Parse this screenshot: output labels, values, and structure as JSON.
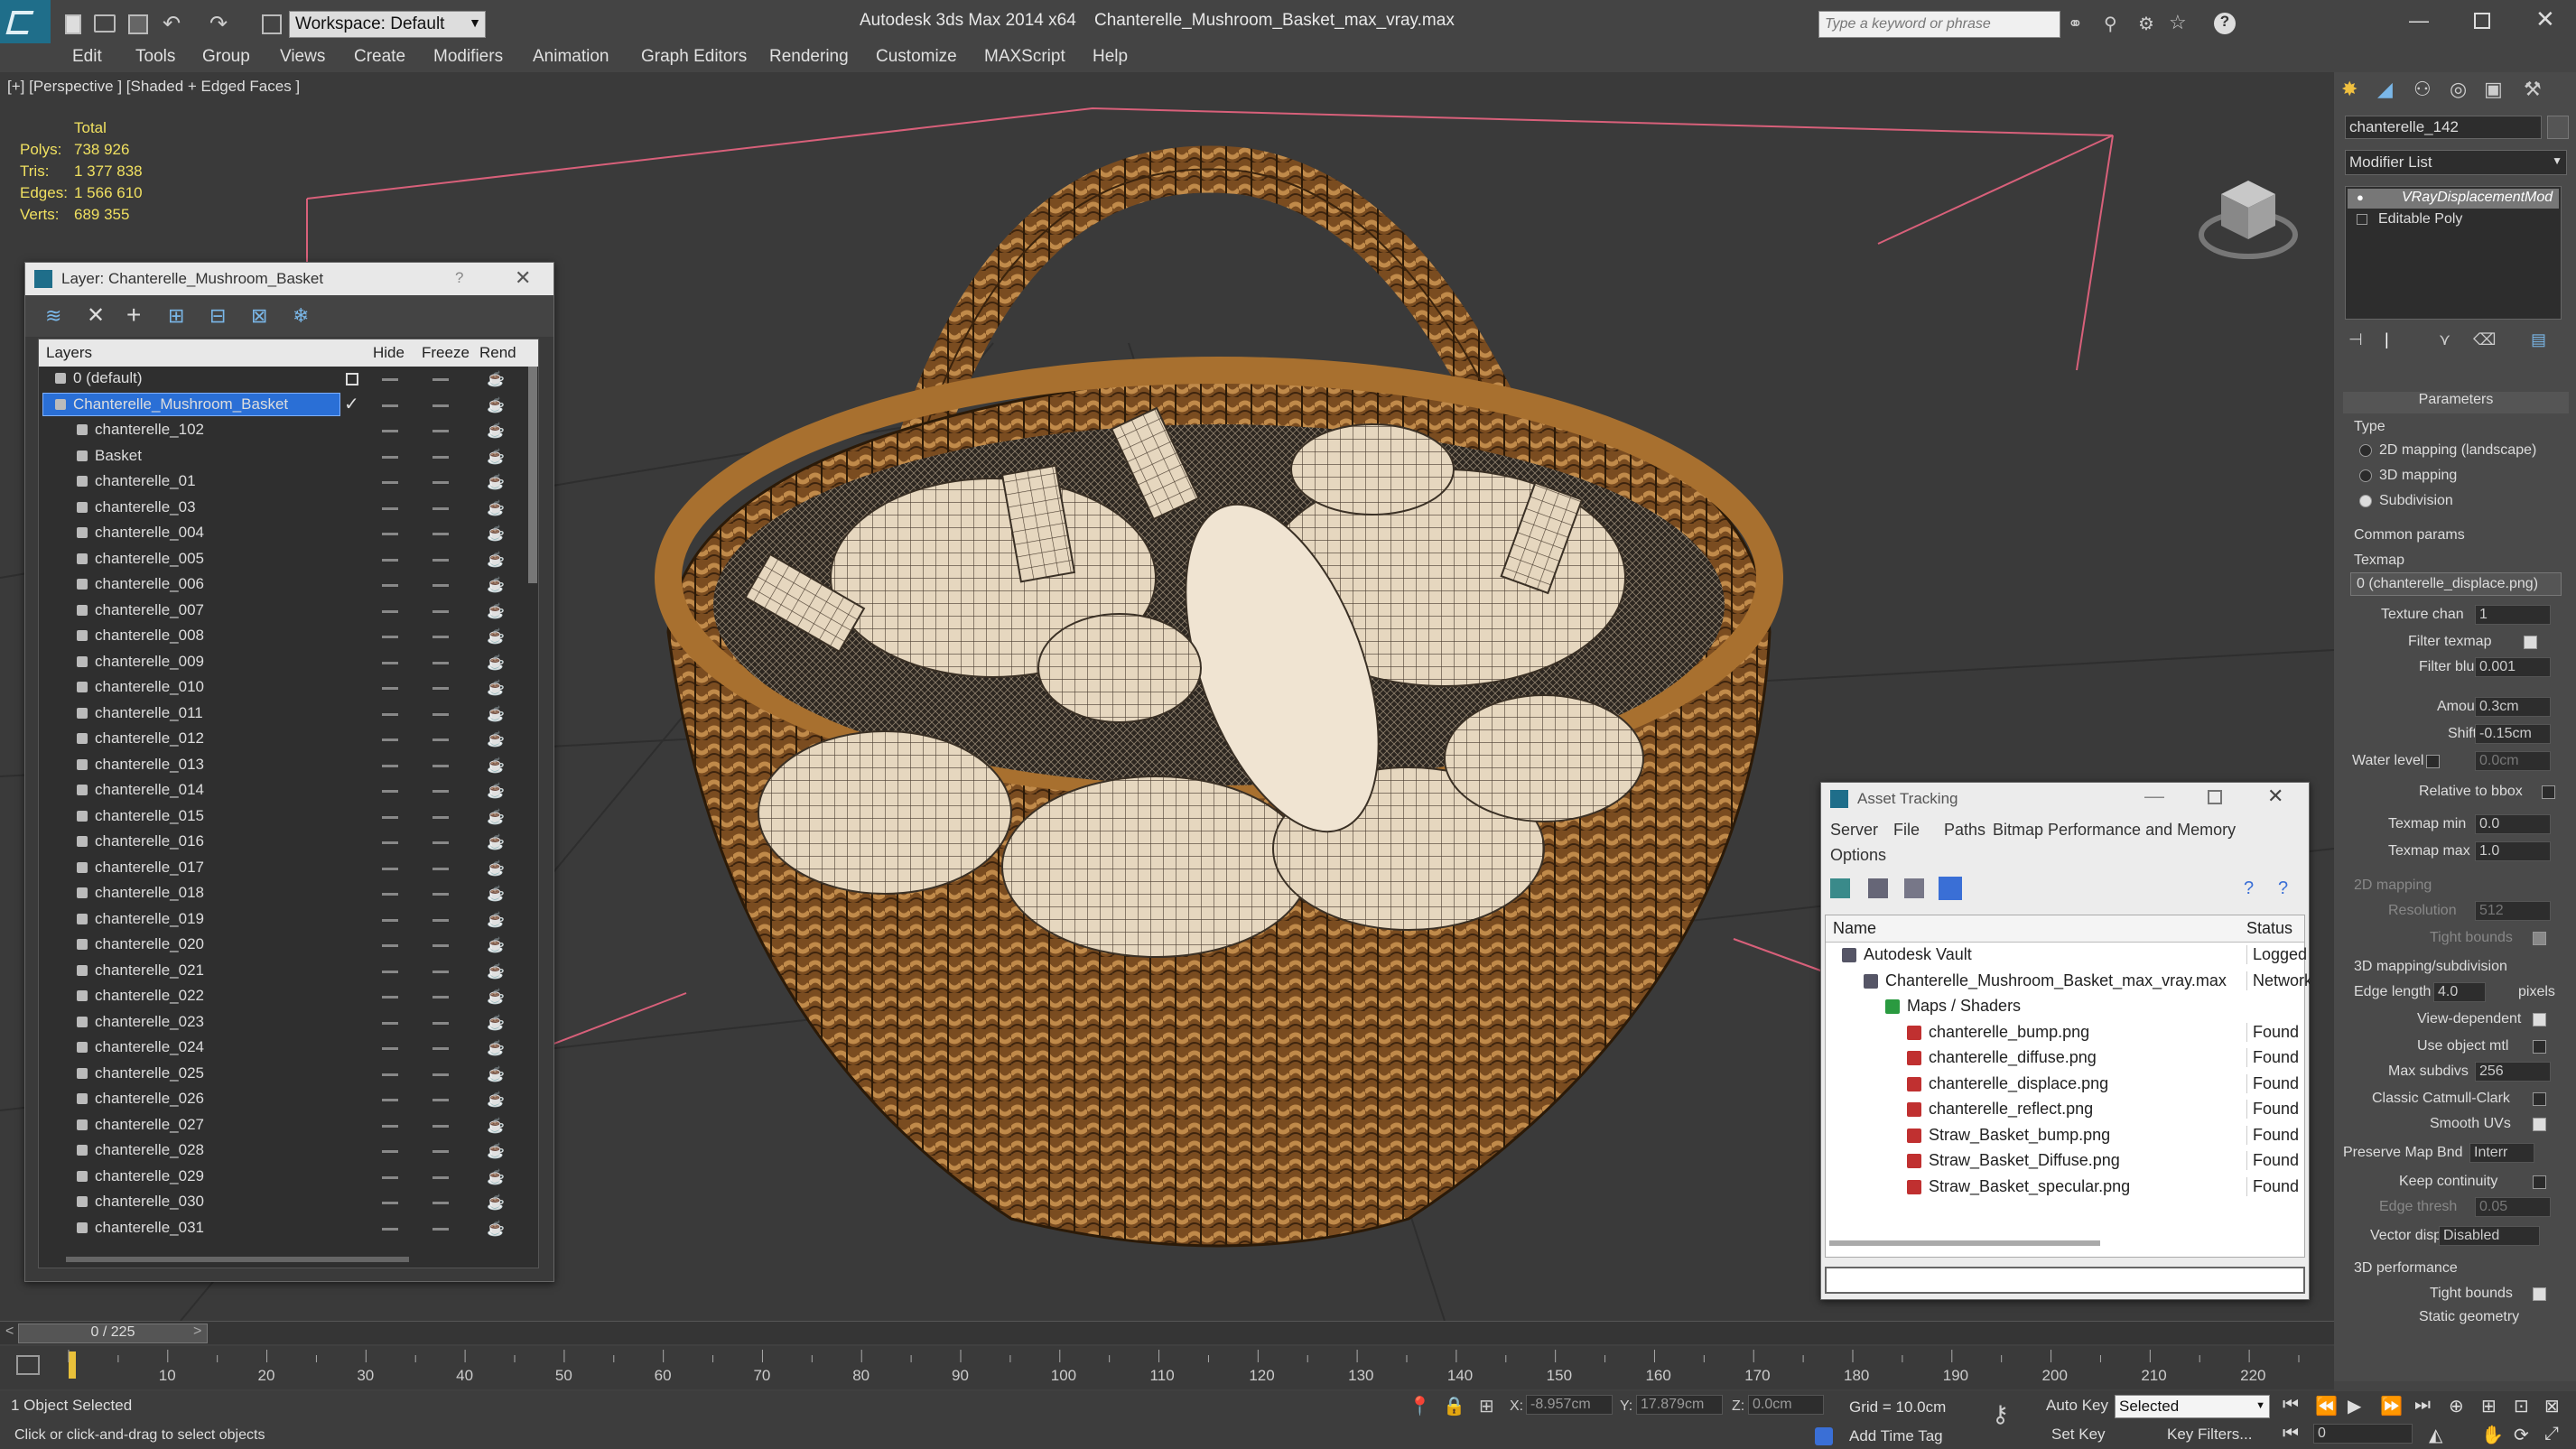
{
  "app": {
    "title": "Autodesk 3ds Max  2014 x64",
    "file": "Chanterelle_Mushroom_Basket_max_vray.max",
    "workspace": "Workspace: Default",
    "search_placeholder": "Type a keyword or phrase"
  },
  "menu": [
    "Edit",
    "Tools",
    "Group",
    "Views",
    "Create",
    "Modifiers",
    "Animation",
    "Graph Editors",
    "Rendering",
    "Customize",
    "MAXScript",
    "Help"
  ],
  "viewport": {
    "label": "[+] [Perspective ] [Shaded + Edged Faces ]",
    "stats": {
      "total_label": "Total",
      "rows": [
        {
          "label": "Polys:",
          "value": "738 926"
        },
        {
          "label": "Tris:",
          "value": "1 377 838"
        },
        {
          "label": "Edges:",
          "value": "1 566 610"
        },
        {
          "label": "Verts:",
          "value": "689 355"
        }
      ]
    }
  },
  "layer_dialog": {
    "title": "Layer: Chanterelle_Mushroom_Basket",
    "help": "?",
    "columns": [
      "Layers",
      "Hide",
      "Freeze",
      "Rend"
    ],
    "layers": [
      {
        "name": "0 (default)",
        "level": 0
      },
      {
        "name": "Chanterelle_Mushroom_Basket",
        "level": 0,
        "selected": true
      },
      {
        "name": "chanterelle_102",
        "level": 1
      },
      {
        "name": "Basket",
        "level": 1
      },
      {
        "name": "chanterelle_01",
        "level": 1
      },
      {
        "name": "chanterelle_03",
        "level": 1
      },
      {
        "name": "chanterelle_004",
        "level": 1
      },
      {
        "name": "chanterelle_005",
        "level": 1
      },
      {
        "name": "chanterelle_006",
        "level": 1
      },
      {
        "name": "chanterelle_007",
        "level": 1
      },
      {
        "name": "chanterelle_008",
        "level": 1
      },
      {
        "name": "chanterelle_009",
        "level": 1
      },
      {
        "name": "chanterelle_010",
        "level": 1
      },
      {
        "name": "chanterelle_011",
        "level": 1
      },
      {
        "name": "chanterelle_012",
        "level": 1
      },
      {
        "name": "chanterelle_013",
        "level": 1
      },
      {
        "name": "chanterelle_014",
        "level": 1
      },
      {
        "name": "chanterelle_015",
        "level": 1
      },
      {
        "name": "chanterelle_016",
        "level": 1
      },
      {
        "name": "chanterelle_017",
        "level": 1
      },
      {
        "name": "chanterelle_018",
        "level": 1
      },
      {
        "name": "chanterelle_019",
        "level": 1
      },
      {
        "name": "chanterelle_020",
        "level": 1
      },
      {
        "name": "chanterelle_021",
        "level": 1
      },
      {
        "name": "chanterelle_022",
        "level": 1
      },
      {
        "name": "chanterelle_023",
        "level": 1
      },
      {
        "name": "chanterelle_024",
        "level": 1
      },
      {
        "name": "chanterelle_025",
        "level": 1
      },
      {
        "name": "chanterelle_026",
        "level": 1
      },
      {
        "name": "chanterelle_027",
        "level": 1
      },
      {
        "name": "chanterelle_028",
        "level": 1
      },
      {
        "name": "chanterelle_029",
        "level": 1
      },
      {
        "name": "chanterelle_030",
        "level": 1
      },
      {
        "name": "chanterelle_031",
        "level": 1
      }
    ]
  },
  "asset_tracking": {
    "title": "Asset Tracking",
    "menu": [
      "Server",
      "File",
      "Paths",
      "Bitmap Performance and Memory",
      "Options"
    ],
    "columns": [
      "Name",
      "Status"
    ],
    "rows": [
      {
        "name": "Autodesk Vault",
        "status": "Logged",
        "level": 0
      },
      {
        "name": "Chanterelle_Mushroom_Basket_max_vray.max",
        "status": "Network",
        "level": 1
      },
      {
        "name": "Maps / Shaders",
        "status": "",
        "level": 2
      },
      {
        "name": "chanterelle_bump.png",
        "status": "Found",
        "level": 3
      },
      {
        "name": "chanterelle_diffuse.png",
        "status": "Found",
        "level": 3
      },
      {
        "name": "chanterelle_displace.png",
        "status": "Found",
        "level": 3
      },
      {
        "name": "chanterelle_reflect.png",
        "status": "Found",
        "level": 3
      },
      {
        "name": "Straw_Basket_bump.png",
        "status": "Found",
        "level": 3
      },
      {
        "name": "Straw_Basket_Diffuse.png",
        "status": "Found",
        "level": 3
      },
      {
        "name": "Straw_Basket_specular.png",
        "status": "Found",
        "level": 3
      }
    ]
  },
  "command_panel": {
    "object_name": "chanterelle_142",
    "modifier_list": "Modifier List",
    "stack": [
      "VRayDisplacementMod",
      "Editable Poly"
    ],
    "parameters_title": "Parameters",
    "type_label": "Type",
    "type_options": [
      "2D mapping (landscape)",
      "3D mapping",
      "Subdivision"
    ],
    "type_selected": 2,
    "common_params": "Common params",
    "texmap_label": "Texmap",
    "texmap_value": "0 (chanterelle_displace.png)",
    "texture_chan_label": "Texture chan",
    "texture_chan": "1",
    "filter_texmap": "Filter texmap",
    "filter_blur_label": "Filter blur",
    "filter_blur": "0.001",
    "amount_label": "Amount",
    "amount": "0.3cm",
    "shift_label": "Shift",
    "shift": "-0.15cm",
    "water_level_label": "Water level",
    "water_level": "0.0cm",
    "relative_bbox": "Relative to bbox",
    "texmap_min_label": "Texmap min",
    "texmap_min": "0.0",
    "texmap_max_label": "Texmap max",
    "texmap_max": "1.0",
    "mapping_2d": "2D mapping",
    "resolution_label": "Resolution",
    "resolution": "512",
    "tight_bounds": "Tight bounds",
    "mapping_3d": "3D mapping/subdivision",
    "edge_length_label": "Edge length",
    "edge_length": "4.0",
    "pixels": "pixels",
    "view_dependent": "View-dependent",
    "use_object_mtl": "Use object mtl",
    "max_subdivs_label": "Max subdivs",
    "max_subdivs": "256",
    "classic_catmull": "Classic Catmull-Clark",
    "smooth_uvs": "Smooth UVs",
    "preserve_map_label": "Preserve Map Bnd",
    "preserve_map": "Interr",
    "keep_continuity": "Keep continuity",
    "edge_thresh_label": "Edge thresh",
    "edge_thresh": "0.05",
    "vector_displ_label": "Vector displ",
    "vector_displ": "Disabled",
    "perf_3d": "3D performance",
    "tight_bounds2": "Tight bounds",
    "static_geometry": "Static geometry"
  },
  "timeline": {
    "frame": "0 / 225",
    "ticks": [
      "10",
      "20",
      "30",
      "40",
      "50",
      "60",
      "70",
      "80",
      "90",
      "100",
      "110",
      "120",
      "130",
      "140",
      "150",
      "160",
      "170",
      "180",
      "190",
      "200",
      "210",
      "220"
    ]
  },
  "status": {
    "selected": "1 Object Selected",
    "hint": "Click or click-and-drag to select objects",
    "x_label": "X:",
    "x": "-8.957cm",
    "y_label": "Y:",
    "y": "17.879cm",
    "z_label": "Z:",
    "z": "0.0cm",
    "grid": "Grid = 10.0cm",
    "add_time_tag": "Add Time Tag",
    "auto_key": "Auto Key",
    "set_key": "Set Key",
    "selected_dropdown": "Selected",
    "key_filters": "Key Filters...",
    "frame_field": "0"
  },
  "colors": {
    "accent_blue": "#2a6fd6",
    "wicker": "#8a5a28",
    "mushroom": "#e9dcc6"
  }
}
